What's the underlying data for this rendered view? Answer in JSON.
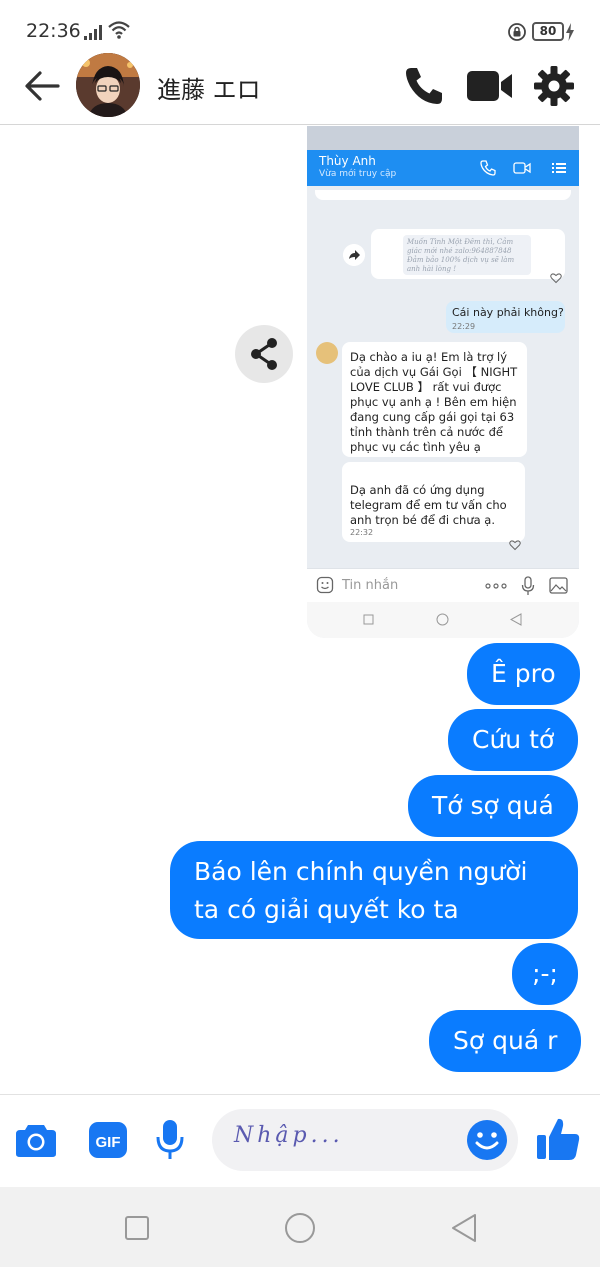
{
  "status_bar": {
    "time": "22:36",
    "battery": "80"
  },
  "header": {
    "contact_name": "進藤 エロ"
  },
  "shared_screenshot": {
    "contact_name": "Thùy Anh",
    "contact_status": "Vừa mới truy cập",
    "forwarded_text": "Muốn Tình Một Đêm thì, Cảm giác mới nhé zalo:964887848 Đảm bảo 100% dịch vụ sẽ làm anh hài lòng !",
    "outgoing": {
      "text": "Cái này phải không?",
      "time": "22:29"
    },
    "incoming": [
      {
        "text": "Dạ chào a iu ạ! Em là trợ lý của dịch vụ Gái Gọi 【 NIGHT LOVE CLUB 】 rất vui được phục vụ anh ạ ! Bên em hiện đang cung cấp gái gọi tại 63 tỉnh thành trên cả nước để phục vụ các tình yêu ạ"
      },
      {
        "text": "Dạ anh đã có ứng dụng telegram để em tư vấn cho anh trọn bé để đi chưa ạ.",
        "time": "22:32"
      }
    ],
    "input_placeholder": "Tin nhắn"
  },
  "messages": [
    {
      "text": "Ê pro"
    },
    {
      "text": "Cứu tớ"
    },
    {
      "text": "Tớ sợ quá"
    },
    {
      "text": "Báo lên chính quyền người ta có giải quyết ko ta"
    },
    {
      "text": ";-;"
    },
    {
      "text": "Sợ quá r"
    }
  ],
  "composer": {
    "placeholder": "Nhập..."
  },
  "colors": {
    "accent": "#0a7cff",
    "icon": "#1877f2",
    "header_icon": "#222222"
  },
  "icons": [
    "back-arrow-icon",
    "phone-icon",
    "video-camera-icon",
    "gear-icon",
    "share-icon",
    "camera-icon",
    "gif-icon",
    "microphone-icon",
    "emoji-icon",
    "thumbs-up-icon"
  ]
}
